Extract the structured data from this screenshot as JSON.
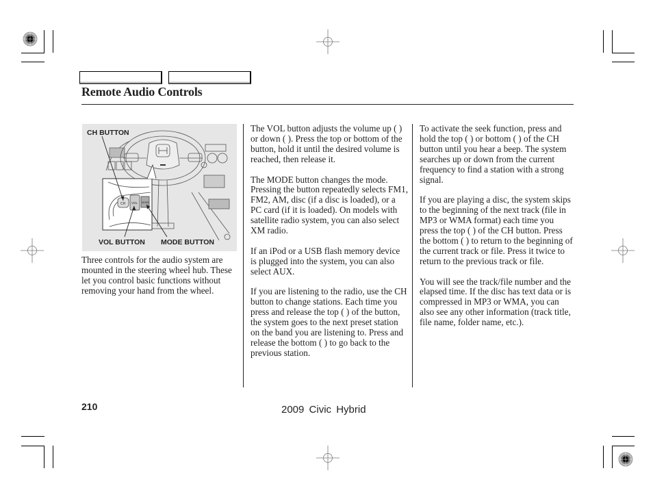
{
  "header": {
    "tabs": [
      "",
      ""
    ],
    "title": "Remote Audio Controls"
  },
  "figure": {
    "labels": {
      "ch": "CH BUTTON",
      "vol": "VOL BUTTON",
      "mode": "MODE BUTTON"
    },
    "button_glyphs": {
      "ch": "CH",
      "vol": "VOL",
      "mode": "MODE"
    }
  },
  "columns": {
    "left": [
      "Three controls for the audio system are mounted in the steering wheel hub. These let you control basic functions without removing your hand from the wheel."
    ],
    "middle": [
      "The VOL button adjusts the volume up (    ) or down (    ). Press the top or bottom of the button, hold it until the desired volume is reached, then release it.",
      "The MODE button changes the mode. Pressing the button repeatedly selects FM1, FM2, AM, disc (if a disc is loaded), or a PC card (if it is loaded). On models with satellite radio system, you can also select XM radio.",
      "If an iPod or a USB flash memory device is plugged into the system, you can also select AUX.",
      "If you are listening to the radio, use the CH button to change stations. Each time you press and release the top (    ) of the button, the system goes to the next preset station on the band you are listening to. Press and release the bottom (    ) to go back to the previous station."
    ],
    "right": [
      "To activate the seek function, press and hold the top (    ) or bottom (    ) of the CH button until you hear a beep. The system searches up or down from the current frequency to find a station with a strong signal.",
      "If you are playing a disc, the system skips to the beginning of the next track (file in MP3 or WMA format) each time you press the top (    ) of the CH button. Press the bottom (    ) to return to the beginning of the current track or file. Press it twice to return to the previous track or file.",
      "You will see the track/file number and the elapsed time. If the disc has text data or is compressed in MP3 or WMA, you can also see any other information (track title, file name, folder name, etc.)."
    ]
  },
  "footer": {
    "page_number": "210",
    "book_title": "2009  Civic  Hybrid"
  },
  "icons": {
    "registration_mark": "registration-target",
    "crosshair": "crosshair",
    "crop_mark": "crop-mark"
  }
}
